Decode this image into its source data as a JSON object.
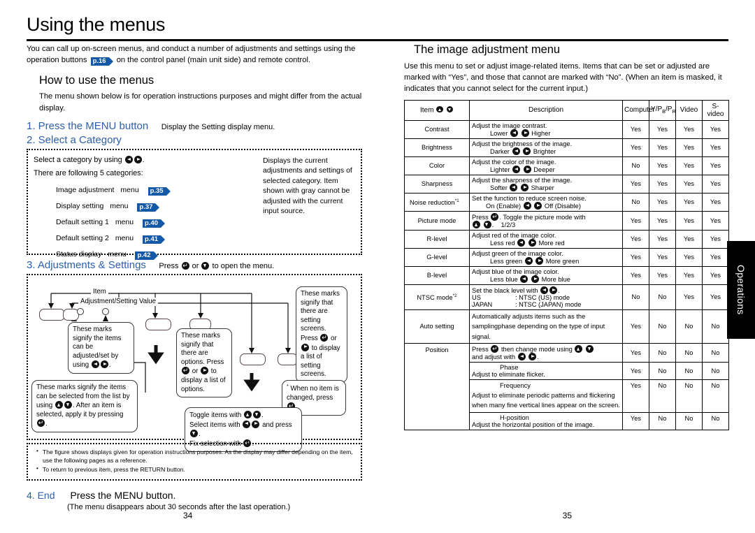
{
  "page_title": "Using the menus",
  "left": {
    "intro": "You can call up on-screen menus, and conduct a number of adjustments and settings using the operation buttons",
    "intro_ref": "p.16",
    "intro_tail": "on the control panel (main unit side) and remote control.",
    "section_heading": "How to use the menus",
    "section_text": "The menu shown below is for operation instructions purposes and might differ from the actual display.",
    "step1_label": "1. Press the MENU button",
    "step1_note": "Display the Setting display   menu.",
    "step2_label": "2. Select a Category",
    "step2_line1_a": "Select a category by using",
    "step2_line1_b": ".",
    "step2_line2": "There are following 5 categories:",
    "categories": [
      {
        "name": "Image adjustment",
        "menu": "menu",
        "ref": "p.35"
      },
      {
        "name": "Display setting",
        "menu": "menu",
        "ref": "p.37"
      },
      {
        "name": "Default setting 1",
        "menu": "menu",
        "ref": "p.40"
      },
      {
        "name": "Default setting 2",
        "menu": "menu",
        "ref": "p.41"
      },
      {
        "name": "Status display",
        "menu": "menu",
        "ref": "p.42"
      }
    ],
    "side_note": "Displays the current adjustments and settings of selected category. Item shown with gray cannot be adjusted with the current input source.",
    "step3_label": "3. Adjustments & Settings",
    "step3_note_a": "Press",
    "step3_note_b": "or",
    "step3_note_c": "to open the menu.",
    "diagram": {
      "label_item": "Item",
      "label_value": "Adjustment/Setting Value",
      "callout_leftright": "These marks signify the items can be adjusted/set by using",
      "callout_leftright_tail": ".",
      "callout_options_a": "These marks signify that there are options.",
      "callout_options_b": "Press",
      "callout_options_or": "or",
      "callout_options_c": "to display a list of options.",
      "callout_screens_a": "These marks signify that there are setting screens. Press",
      "callout_screens_or": "or",
      "callout_screens_b": "to display a list of setting screens.",
      "callout_list_a": "These marks signify the items can be selected from the list by using",
      "callout_list_b": ".",
      "callout_list_c": "After an item is selected, apply it by pressing",
      "callout_list_d": ".",
      "callout_noitem_a": "When no item is changed, press",
      "callout_noitem_b": ".",
      "callout_toggle_1a": "Toggle items with",
      "callout_toggle_1b": ".",
      "callout_toggle_2a": "Select items with",
      "callout_toggle_2b": "and press",
      "callout_toggle_2c": ".",
      "callout_toggle_3a": "Fix selection with",
      "callout_toggle_3b": "."
    },
    "notes": [
      "The figure shows displays given for operation instructions purposes.  As the display may differ depending on the item, use the following pages as a reference.",
      "To return to previous item, press the RETURN button."
    ],
    "step4_label": "4. End",
    "step4_main": "Press the MENU button.",
    "step4_sub": "(The menu disappears about 30 seconds after the last operation.)",
    "folio": "34"
  },
  "right": {
    "heading": "The image adjustment menu",
    "intro": "Use this menu to set or adjust image-related items. Items that can be set or adjusted are marked with “Yes”, and those that cannot are marked with “No”. (When an item is masked, it indicates that you cannot select for the current input.)",
    "table": {
      "headers": [
        "Item",
        "Description",
        "Computer",
        "Y/PB/PR",
        "Video",
        "S-video"
      ],
      "rows": [
        {
          "item": "Contrast",
          "desc_line1": "Adjust the image contrast.",
          "desc_left": "Lower",
          "desc_right": "Higher",
          "values": [
            "Yes",
            "Yes",
            "Yes",
            "Yes"
          ]
        },
        {
          "item": "Brightness",
          "desc_line1": "Adjust the brightness of the image.",
          "desc_left": "Darker",
          "desc_right": "Brighter",
          "values": [
            "Yes",
            "Yes",
            "Yes",
            "Yes"
          ]
        },
        {
          "item": "Color",
          "desc_line1": "Adjust the color of the image.",
          "desc_left": "Lighter",
          "desc_right": "Deeper",
          "values": [
            "No",
            "Yes",
            "Yes",
            "Yes"
          ]
        },
        {
          "item": "Sharpness",
          "desc_line1": "Adjust the sharpness of the image.",
          "desc_left": "Softer",
          "desc_right": "Sharper",
          "values": [
            "Yes",
            "Yes",
            "Yes",
            "Yes"
          ]
        },
        {
          "item": "Noise reduction",
          "item_sup": "*1",
          "desc_line1": "Set the function to reduce screen noise.",
          "desc_left": "On (Enable)",
          "desc_right": "Off (Disable)",
          "values": [
            "No",
            "Yes",
            "Yes",
            "Yes"
          ]
        },
        {
          "item": "Picture mode",
          "desc_press": "Press",
          "desc_line1": ". Toggle the picture mode with",
          "desc_line2": "1/2/3",
          "values": [
            "Yes",
            "Yes",
            "Yes",
            "Yes"
          ]
        },
        {
          "item": "R-level",
          "desc_line1": "Adjust red of the image color.",
          "desc_left": "Less red",
          "desc_right": "More red",
          "values": [
            "Yes",
            "Yes",
            "Yes",
            "Yes"
          ]
        },
        {
          "item": "G-level",
          "desc_line1": "Adjust green of the image color.",
          "desc_left": "Less green",
          "desc_right": "More green",
          "values": [
            "Yes",
            "Yes",
            "Yes",
            "Yes"
          ]
        },
        {
          "item": "B-level",
          "desc_line1": "Adjust blue of the image color.",
          "desc_left": "Less blue",
          "desc_right": "More blue",
          "values": [
            "Yes",
            "Yes",
            "Yes",
            "Yes"
          ]
        },
        {
          "item": "NTSC mode",
          "item_sup": "*2",
          "desc_line1": "Set the black level with",
          "desc_line1_tail": ".",
          "ntsc_key1": "US",
          "ntsc_val1": ":   NTSC (US) mode",
          "ntsc_key2": "JAPAN",
          "ntsc_val2": ":   NTSC (JAPAN) mode",
          "values": [
            "No",
            "No",
            "Yes",
            "Yes"
          ]
        },
        {
          "item": "Auto setting",
          "desc_line1": "Automatically adjusts items such as the samplingphase depending on the type of input signal.",
          "values": [
            "Yes",
            "No",
            "No",
            "No"
          ]
        },
        {
          "item": "Position",
          "desc_press": "Press",
          "desc_line1": "then change mode using",
          "desc_line2": "and adjust with",
          "desc_line2_tail": ".",
          "values": [
            "Yes",
            "No",
            "No",
            "No"
          ]
        },
        {
          "item": "",
          "sub_title": "Phase",
          "desc_line1": "Adjust to eliminate flicker.",
          "values": [
            "Yes",
            "No",
            "No",
            "No"
          ]
        },
        {
          "item": "",
          "sub_title": "Frequency",
          "desc_line1": "Adjust to eliminate periodic patterns and flickering when many fine vertical lines appear on the screen.",
          "values": [
            "Yes",
            "No",
            "No",
            "No"
          ]
        },
        {
          "item": "",
          "sub_title": "H-position",
          "desc_line1": "Adjust the horizontal position of the image.",
          "values": [
            "Yes",
            "No",
            "No",
            "No"
          ]
        }
      ]
    },
    "folio": "35"
  },
  "thumb_tab": "Operations",
  "colors": {
    "link_blue": "#2b5fad",
    "flag_blue": "#1459a8",
    "tab_black": "#000000"
  }
}
